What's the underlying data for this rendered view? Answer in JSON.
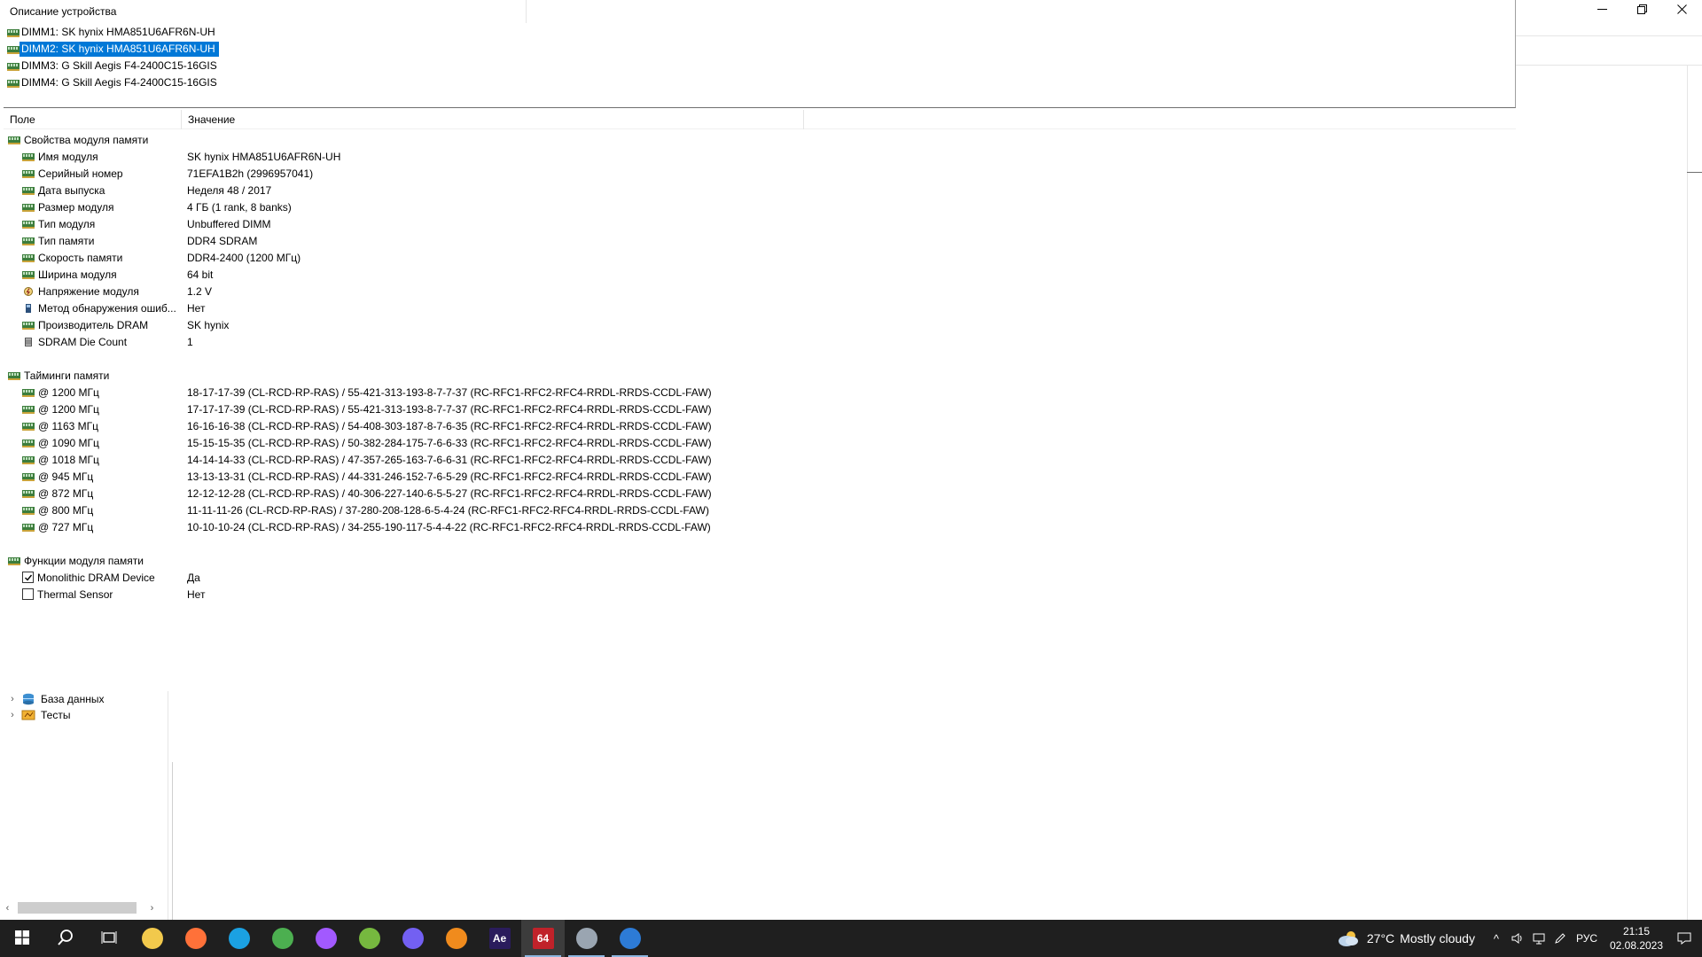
{
  "window": {
    "controls": {
      "minimize": "–",
      "restore": "❐",
      "close": "✕"
    }
  },
  "device_description": {
    "header": "Описание устройства",
    "items": [
      {
        "label": "DIMM1: SK hynix HMA851U6AFR6N-UH",
        "selected": false
      },
      {
        "label": "DIMM2: SK hynix HMA851U6AFR6N-UH",
        "selected": true
      },
      {
        "label": "DIMM3: G Skill Aegis F4-2400C15-16GIS",
        "selected": false
      },
      {
        "label": "DIMM4: G Skill Aegis F4-2400C15-16GIS",
        "selected": false
      }
    ]
  },
  "properties": {
    "columns": {
      "field": "Поле",
      "value": "Значение"
    },
    "groups": [
      {
        "title": "Свойства модуля памяти",
        "rows": [
          {
            "icon": "ram-icon",
            "field": "Имя модуля",
            "value": "SK hynix HMA851U6AFR6N-UH"
          },
          {
            "icon": "ram-icon",
            "field": "Серийный номер",
            "value": "71EFA1B2h (2996957041)"
          },
          {
            "icon": "ram-icon",
            "field": "Дата выпуска",
            "value": "Неделя 48 / 2017"
          },
          {
            "icon": "ram-icon",
            "field": "Размер модуля",
            "value": "4 ГБ (1 rank, 8 banks)"
          },
          {
            "icon": "ram-icon",
            "field": "Тип модуля",
            "value": "Unbuffered DIMM"
          },
          {
            "icon": "ram-icon",
            "field": "Тип памяти",
            "value": "DDR4 SDRAM"
          },
          {
            "icon": "ram-icon",
            "field": "Скорость памяти",
            "value": "DDR4-2400 (1200 МГц)"
          },
          {
            "icon": "ram-icon",
            "field": "Ширина модуля",
            "value": "64 bit"
          },
          {
            "icon": "voltage-icon",
            "field": "Напряжение модуля",
            "value": "1.2 V"
          },
          {
            "icon": "error-detect-icon",
            "field": "Метод обнаружения ошиб...",
            "value": "Нет"
          },
          {
            "icon": "ram-icon",
            "field": "Производитель DRAM",
            "value": "SK hynix"
          },
          {
            "icon": "die-icon",
            "field": "SDRAM Die Count",
            "value": "1"
          }
        ]
      },
      {
        "title": "Тайминги памяти",
        "rows": [
          {
            "icon": "ram-icon",
            "field": "@ 1200 МГц",
            "value": "18-17-17-39  (CL-RCD-RP-RAS) / 55-421-313-193-8-7-7-37  (RC-RFC1-RFC2-RFC4-RRDL-RRDS-CCDL-FAW)"
          },
          {
            "icon": "ram-icon",
            "field": "@ 1200 МГц",
            "value": "17-17-17-39  (CL-RCD-RP-RAS) / 55-421-313-193-8-7-7-37  (RC-RFC1-RFC2-RFC4-RRDL-RRDS-CCDL-FAW)"
          },
          {
            "icon": "ram-icon",
            "field": "@ 1163 МГц",
            "value": "16-16-16-38  (CL-RCD-RP-RAS) / 54-408-303-187-8-7-6-35  (RC-RFC1-RFC2-RFC4-RRDL-RRDS-CCDL-FAW)"
          },
          {
            "icon": "ram-icon",
            "field": "@ 1090 МГц",
            "value": "15-15-15-35  (CL-RCD-RP-RAS) / 50-382-284-175-7-6-6-33  (RC-RFC1-RFC2-RFC4-RRDL-RRDS-CCDL-FAW)"
          },
          {
            "icon": "ram-icon",
            "field": "@ 1018 МГц",
            "value": "14-14-14-33  (CL-RCD-RP-RAS) / 47-357-265-163-7-6-6-31  (RC-RFC1-RFC2-RFC4-RRDL-RRDS-CCDL-FAW)"
          },
          {
            "icon": "ram-icon",
            "field": "@ 945 МГц",
            "value": "13-13-13-31  (CL-RCD-RP-RAS) / 44-331-246-152-7-6-5-29  (RC-RFC1-RFC2-RFC4-RRDL-RRDS-CCDL-FAW)"
          },
          {
            "icon": "ram-icon",
            "field": "@ 872 МГц",
            "value": "12-12-12-28  (CL-RCD-RP-RAS) / 40-306-227-140-6-5-5-27  (RC-RFC1-RFC2-RFC4-RRDL-RRDS-CCDL-FAW)"
          },
          {
            "icon": "ram-icon",
            "field": "@ 800 МГц",
            "value": "11-11-11-26  (CL-RCD-RP-RAS) / 37-280-208-128-6-5-4-24  (RC-RFC1-RFC2-RFC4-RRDL-RRDS-CCDL-FAW)"
          },
          {
            "icon": "ram-icon",
            "field": "@ 727 МГц",
            "value": "10-10-10-24  (CL-RCD-RP-RAS) / 34-255-190-117-5-4-4-22  (RC-RFC1-RFC2-RFC4-RRDL-RRDS-CCDL-FAW)"
          }
        ]
      },
      {
        "title": "Функции модуля памяти",
        "rows": [
          {
            "icon": "checkbox",
            "checked": true,
            "field": "Monolithic DRAM Device",
            "value": "Да"
          },
          {
            "icon": "checkbox",
            "checked": false,
            "field": "Thermal Sensor",
            "value": "Нет"
          }
        ]
      }
    ]
  },
  "tree": {
    "items": [
      {
        "label": "База данных",
        "icon": "database-icon"
      },
      {
        "label": "Тесты",
        "icon": "tests-icon"
      }
    ]
  },
  "taskbar": {
    "apps": [
      {
        "name": "start-button",
        "icon": "windows-icon"
      },
      {
        "name": "search-button",
        "icon": "search-icon"
      },
      {
        "name": "task-view-button",
        "icon": "task-view-icon"
      },
      {
        "name": "file-explorer-app",
        "icon": "folder-icon",
        "color": "#f2c94c"
      },
      {
        "name": "firefox-app",
        "icon": "firefox-icon",
        "color": "#ff7139"
      },
      {
        "name": "edge-app",
        "icon": "edge-icon",
        "color": "#1ba1e2"
      },
      {
        "name": "chrome-app",
        "icon": "chrome-icon",
        "color": "#4caf50"
      },
      {
        "name": "figma-app",
        "icon": "figma-icon",
        "color": "#a259ff"
      },
      {
        "name": "utorrent-app",
        "icon": "utorrent-icon",
        "color": "#76b83f"
      },
      {
        "name": "viber-app",
        "icon": "viber-icon",
        "color": "#7360f2"
      },
      {
        "name": "vlc-app",
        "icon": "vlc-icon",
        "color": "#f08b1d"
      },
      {
        "name": "after-effects-app",
        "icon": "after-effects-icon",
        "color": "#2a1c5c",
        "label": "Ae"
      },
      {
        "name": "aida64-app",
        "icon": "aida64-icon",
        "color": "#c0222a",
        "label": "64",
        "active": true
      },
      {
        "name": "settings-app",
        "icon": "settings-icon",
        "color": "#9aa5b1",
        "underline": true
      },
      {
        "name": "photos-app",
        "icon": "photos-icon",
        "color": "#2d7bd6",
        "underline": true
      }
    ],
    "weather": {
      "temp": "27°C",
      "desc": "Mostly cloudy"
    },
    "tray": {
      "language": "РУС",
      "time": "21:15",
      "date": "02.08.2023"
    }
  }
}
